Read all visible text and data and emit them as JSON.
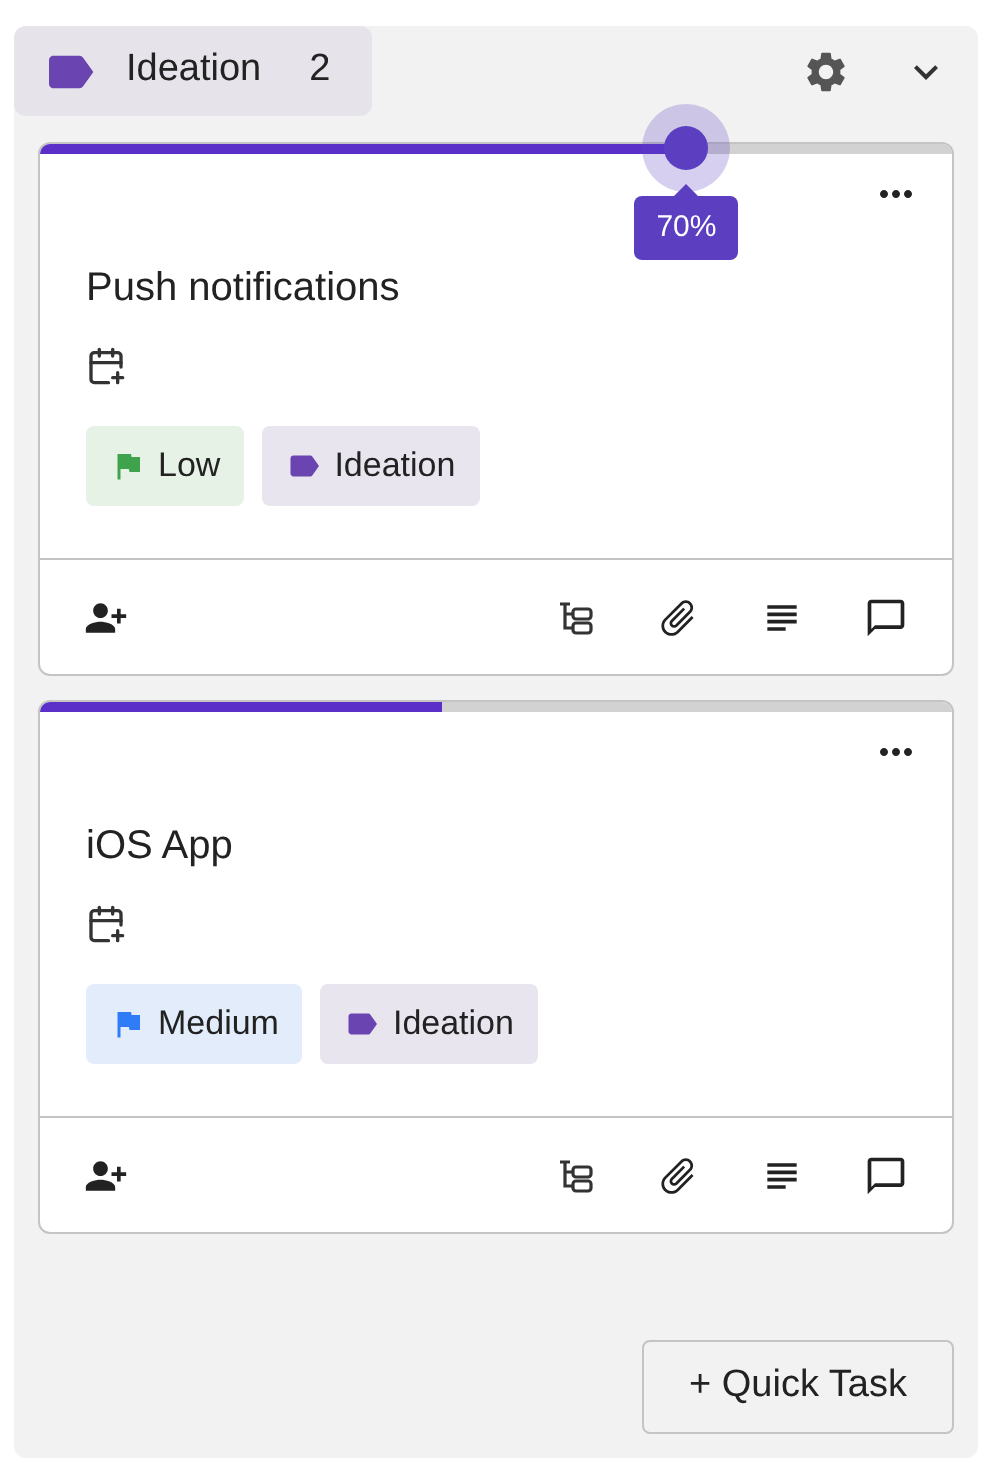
{
  "column": {
    "label": "Ideation",
    "count": "2"
  },
  "cards": [
    {
      "title": "Push notifications",
      "progress": {
        "level": 0.7,
        "reading": "70%"
      },
      "priority": {
        "label": "Low",
        "color": "#3fa34d"
      },
      "tag": {
        "label": "Ideation"
      }
    },
    {
      "title": "iOS App",
      "progress": {
        "level": 0.44
      },
      "priority": {
        "label": "Medium",
        "color": "#2f7cf6"
      },
      "tag": {
        "label": "Ideation"
      }
    }
  ],
  "quick_task": {
    "label": "+ Quick Task"
  }
}
